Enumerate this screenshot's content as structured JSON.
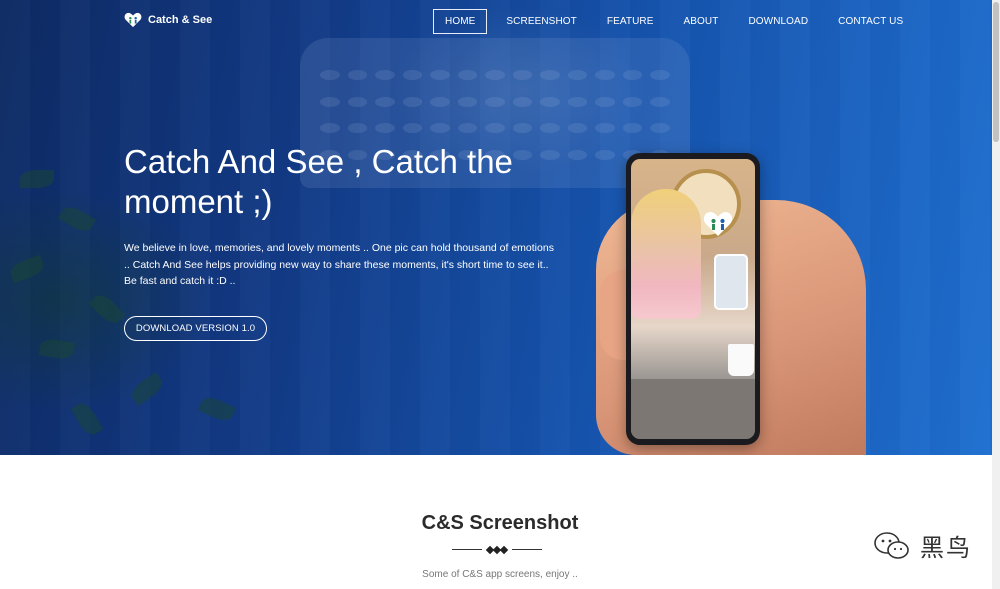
{
  "brand": {
    "name": "Catch & See",
    "logo_icon": "heart-people-icon"
  },
  "nav": {
    "items": [
      {
        "label": "HOME",
        "active": true
      },
      {
        "label": "SCREENSHOT",
        "active": false
      },
      {
        "label": "FEATURE",
        "active": false
      },
      {
        "label": "ABOUT",
        "active": false
      },
      {
        "label": "DOWNLOAD",
        "active": false
      },
      {
        "label": "CONTACT US",
        "active": false
      }
    ]
  },
  "hero": {
    "headline": "Catch And See , Catch the moment ;)",
    "description": "We believe in love, memories, and lovely moments .. One pic can hold thousand of emotions .. Catch And See helps providing new way to share these moments, it's short time to see it.. Be fast and catch it :D ..",
    "cta_label": "DOWNLOAD VERSION 1.0",
    "phone_icon": "phone-mockup-icon"
  },
  "screenshot_section": {
    "title": "C&S Screenshot",
    "subtitle": "Some of C&S app screens, enjoy .."
  },
  "watermark": {
    "text": "黑鸟",
    "icon": "wechat-icon"
  },
  "colors": {
    "hero_start": "#0d2a63",
    "hero_end": "#1f6fd0",
    "accent_white": "#ffffff",
    "heading_dark": "#2b2b2b"
  }
}
